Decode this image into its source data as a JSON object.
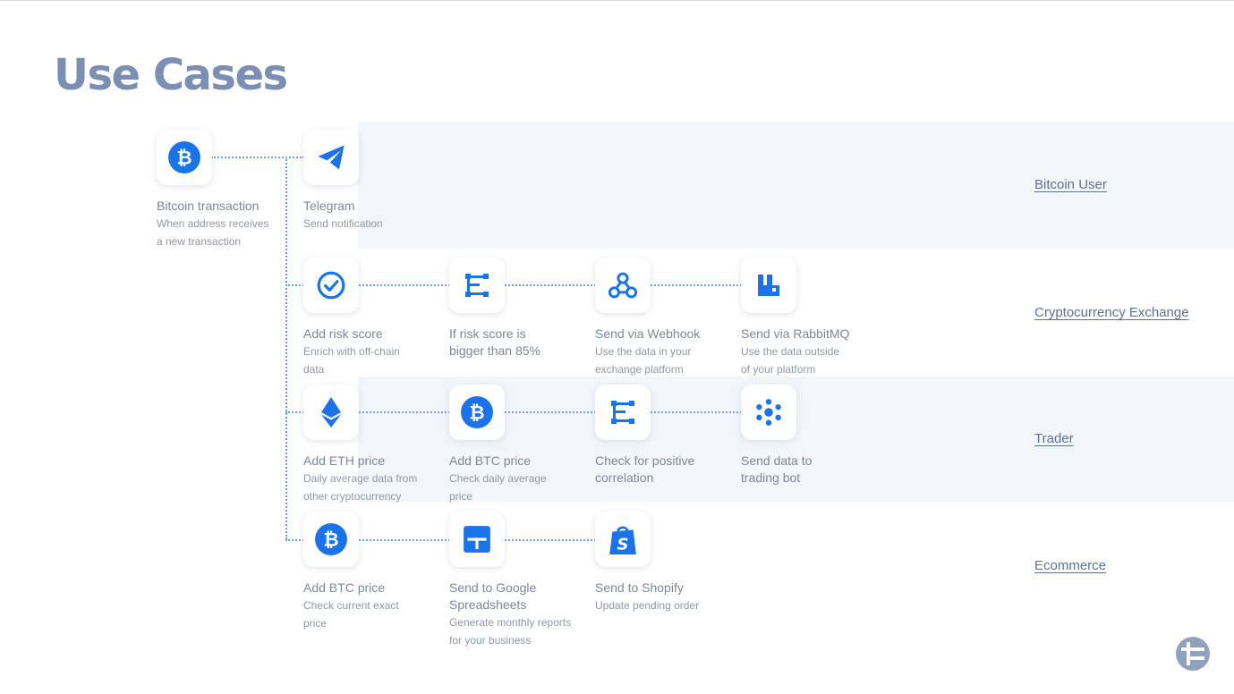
{
  "title": "Use Cases",
  "colors": {
    "accent": "#1a73e8",
    "connector": "#6f9fe6",
    "title": "#7b8fb4",
    "band": "#f2f6fb"
  },
  "trigger": {
    "icon": "bitcoin-icon",
    "title": "Bitcoin transaction",
    "desc": "When address receives\na new transaction"
  },
  "rows": [
    {
      "lane": "Bitcoin User",
      "nodes": [
        {
          "icon": "telegram-icon",
          "title": "Telegram",
          "desc": "Send notification"
        }
      ]
    },
    {
      "lane": "Cryptocurrency Exchange",
      "nodes": [
        {
          "icon": "check-circle-icon",
          "title": "Add risk score",
          "desc": "Enrich with off-chain\ndata"
        },
        {
          "icon": "condition-icon",
          "title": "If risk score is\nbigger than 85%",
          "desc": ""
        },
        {
          "icon": "webhook-icon",
          "title": "Send via Webhook",
          "desc": "Use the data in your\nexchange platform"
        },
        {
          "icon": "rabbitmq-icon",
          "title": "Send via RabbitMQ",
          "desc": "Use the data outside\nof your platform"
        }
      ]
    },
    {
      "lane": "Trader",
      "nodes": [
        {
          "icon": "ethereum-icon",
          "title": "Add ETH price",
          "desc": "Daily average data from\nother cryptocurrency"
        },
        {
          "icon": "bitcoin-icon",
          "title": "Add BTC price",
          "desc": "Check daily average\nprice"
        },
        {
          "icon": "condition-icon",
          "title": "Check for positive\ncorrelation",
          "desc": ""
        },
        {
          "icon": "bot-hub-icon",
          "title": "Send data to\ntrading bot",
          "desc": ""
        }
      ]
    },
    {
      "lane": "Ecommerce",
      "nodes": [
        {
          "icon": "bitcoin-icon",
          "title": "Add BTC price",
          "desc": "Check current exact\nprice"
        },
        {
          "icon": "google-sheets-icon",
          "title": "Send to Google\nSpreadsheets",
          "desc": "Generate monthly reports\nfor your business"
        },
        {
          "icon": "shopify-icon",
          "title": "Send to Shopify",
          "desc": "Update pending order"
        }
      ]
    }
  ]
}
